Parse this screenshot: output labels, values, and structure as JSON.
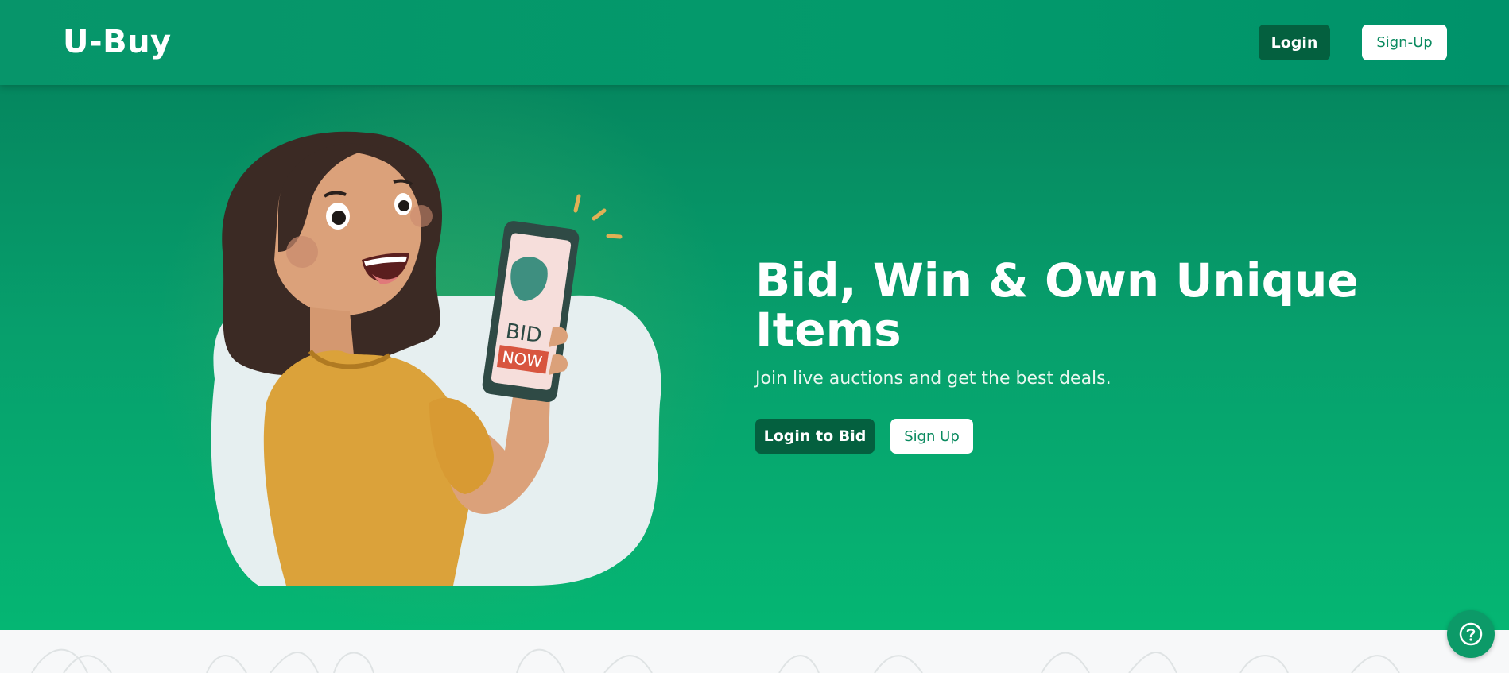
{
  "header": {
    "brand": "U-Buy",
    "login_label": "Login",
    "signup_label": "Sign-Up"
  },
  "hero": {
    "title": "Bid, Win & Own Unique Items",
    "subtitle": "Join live auctions and get the best deals.",
    "login_cta": "Login to Bid",
    "signup_cta": "Sign Up",
    "phone_text_top": "BID",
    "phone_text_bottom": "NOW"
  },
  "help": {
    "icon": "help-icon"
  },
  "colors": {
    "primary": "#07956a",
    "dark_button": "#04603f",
    "light_text": "#ffffff"
  }
}
